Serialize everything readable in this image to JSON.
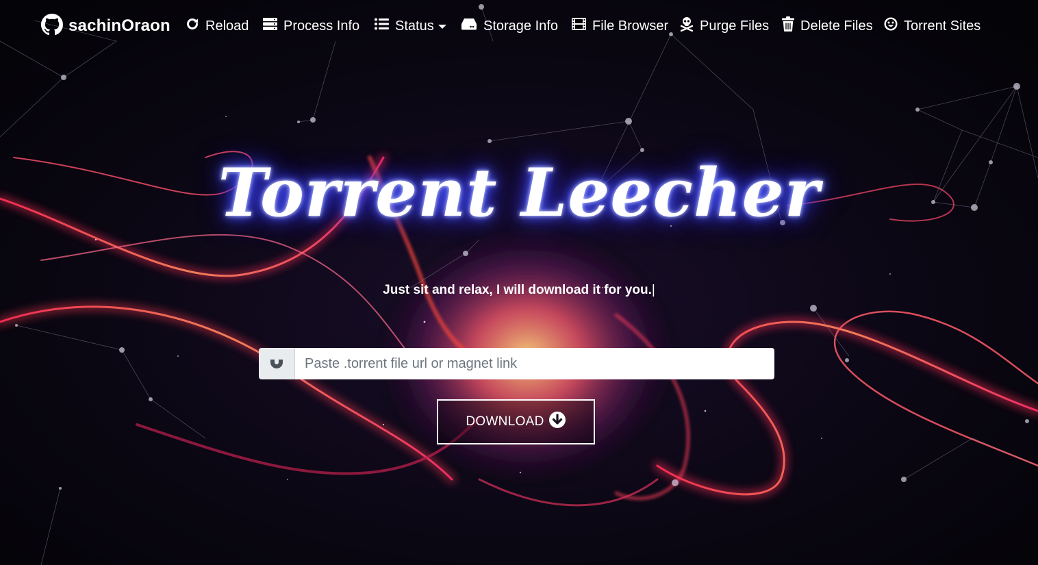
{
  "brand": {
    "name": "sachinOraon",
    "icon": "github-icon"
  },
  "nav": {
    "items": [
      {
        "label": "Reload",
        "icon": "reload-icon"
      },
      {
        "label": "Process Info",
        "icon": "server-icon"
      },
      {
        "label": "Status",
        "icon": "list-icon",
        "dropdown": true
      },
      {
        "label": "Storage Info",
        "icon": "hard-drive-icon"
      },
      {
        "label": "File Browser",
        "icon": "film-icon"
      },
      {
        "label": "Purge Files",
        "icon": "skull-crossbones-icon"
      },
      {
        "label": "Delete Files",
        "icon": "trash-icon"
      },
      {
        "label": "Torrent Sites",
        "icon": "smile-icon"
      }
    ]
  },
  "hero": {
    "title": "Torrent Leecher",
    "tagline": "Just sit and relax, I will download it for you.",
    "cursor": "|"
  },
  "search": {
    "placeholder": "Paste .torrent file url or magnet link",
    "value": "",
    "addon_icon": "magnet-icon"
  },
  "download": {
    "label": "DOWNLOAD",
    "icon": "arrow-circle-down-icon"
  },
  "colors": {
    "background": "#07050c",
    "glow": "#3a44ff",
    "flame": "#ff3d5a",
    "flame_core": "#ffb04a",
    "input_addon": "#e9ecef"
  }
}
